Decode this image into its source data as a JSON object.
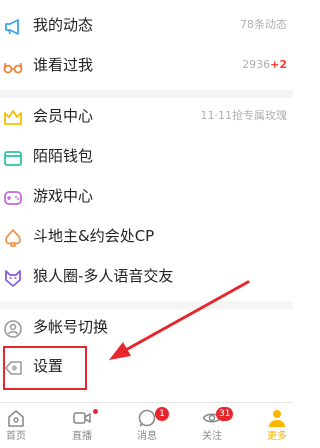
{
  "menu": {
    "items": [
      {
        "label": "我的动态",
        "meta": "78条动态"
      },
      {
        "label": "谁看过我",
        "meta": "2936",
        "meta_plus": "+2"
      },
      {
        "label": "会员中心",
        "meta": "11·11抢专属玫瑰"
      },
      {
        "label": "陌陌钱包"
      },
      {
        "label": "游戏中心"
      },
      {
        "label": "斗地主&约会处CP"
      },
      {
        "label": "狼人圈-多人语音交友"
      },
      {
        "label": "多帐号切换"
      },
      {
        "label": "设置"
      }
    ]
  },
  "tabbar": {
    "tabs": [
      {
        "label": "首页"
      },
      {
        "label": "直播"
      },
      {
        "label": "消息",
        "badge": "1"
      },
      {
        "label": "关注",
        "badge": "31"
      },
      {
        "label": "更多"
      }
    ]
  },
  "colors": {
    "accent": "#ffb400",
    "highlight": "#e8262e",
    "badge": "#e8262e"
  }
}
